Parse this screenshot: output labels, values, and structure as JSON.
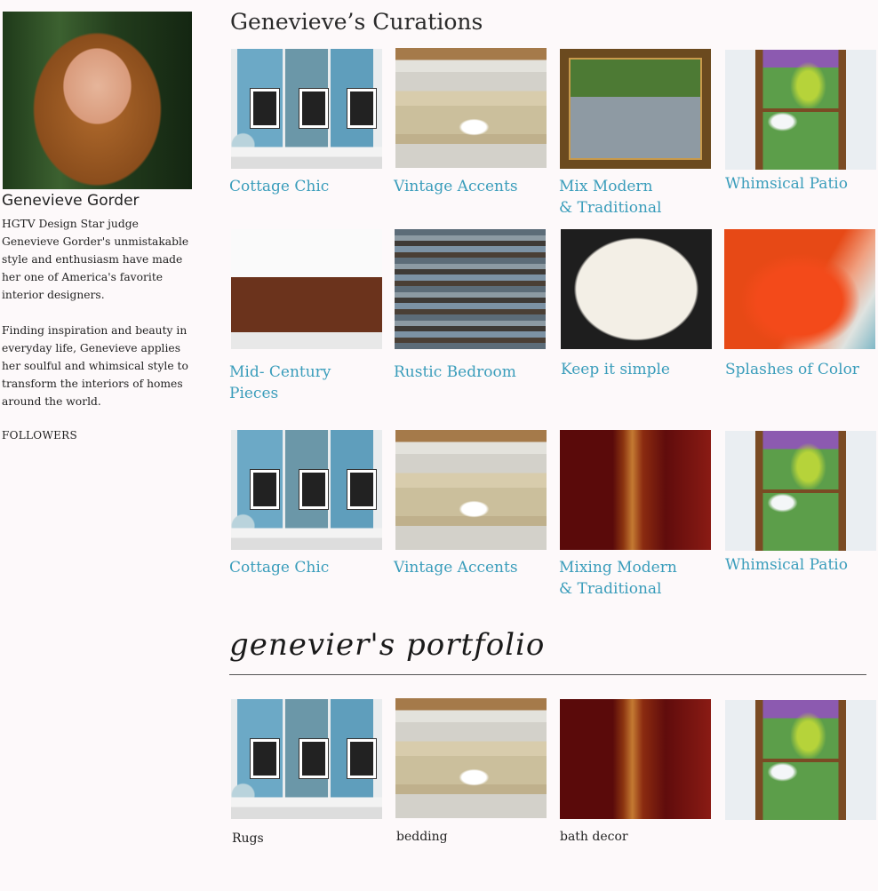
{
  "sidebar": {
    "name": "Genevieve Gorder",
    "bio_1": "HGTV Design Star judge Genevieve Gorder's unmistakable style and enthusiasm have made her one of America's favorite interior designers.",
    "bio_2": "Finding inspiration and beauty in everyday life, Genevieve applies her soulful and whimsical style to transform the interiors of homes around the world.",
    "followers_label": "FOLLOWERS"
  },
  "main": {
    "title": "Genevieve’s Curations",
    "rows": [
      [
        {
          "line1": "Cottage Chic",
          "line2": ""
        },
        {
          "line1": "Vintage Accents",
          "line2": ""
        },
        {
          "line1": "Mix Modern",
          "line2": "& Traditional"
        },
        {
          "line1": "Whimsical Patio",
          "line2": ""
        }
      ],
      [
        {
          "line1": "Mid- Century",
          "line2": "Pieces"
        },
        {
          "line1": "Rustic Bedroom",
          "line2": ""
        },
        {
          "line1": "Keep it simple",
          "line2": ""
        },
        {
          "line1": "Splashes of Color",
          "line2": ""
        }
      ],
      [
        {
          "line1": "Cottage Chic",
          "line2": ""
        },
        {
          "line1": "Vintage Accents",
          "line2": ""
        },
        {
          "line1": "Mixing Modern",
          "line2": "& Traditional"
        },
        {
          "line1": "Whimsical Patio",
          "line2": ""
        }
      ]
    ]
  },
  "portfolio": {
    "title": "genevier's portfolio",
    "items": [
      "Rugs",
      "bedding",
      "bath decor",
      ""
    ]
  }
}
